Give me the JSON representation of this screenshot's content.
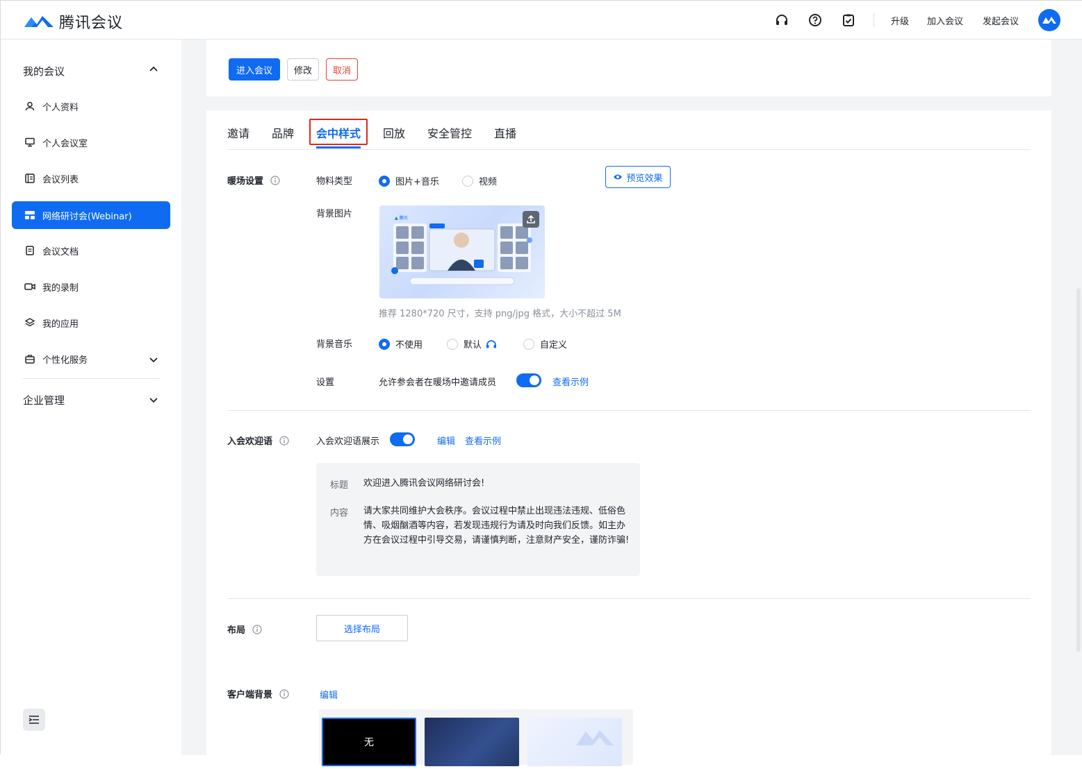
{
  "app": {
    "name": "腾讯会议"
  },
  "topbar": {
    "links": {
      "upgrade": "升级",
      "join": "加入会议",
      "start": "发起会议"
    },
    "icons": [
      "headset-icon",
      "help-icon",
      "clipboard-check-icon"
    ]
  },
  "sidebar": {
    "group_my": "我的会议",
    "items": [
      {
        "label": "个人资料",
        "icon": "user-icon"
      },
      {
        "label": "个人会议室",
        "icon": "monitor-icon"
      },
      {
        "label": "会议列表",
        "icon": "list-icon"
      },
      {
        "label": "网络研讨会(Webinar)",
        "icon": "webinar-icon",
        "active": true
      },
      {
        "label": "会议文档",
        "icon": "document-icon"
      },
      {
        "label": "我的录制",
        "icon": "video-icon"
      },
      {
        "label": "我的应用",
        "icon": "layers-icon"
      },
      {
        "label": "个性化服务",
        "icon": "briefcase-icon"
      }
    ],
    "group_enterprise": "企业管理"
  },
  "actions": {
    "enter": "进入会议",
    "edit": "修改",
    "cancel": "取消"
  },
  "tabs": [
    "邀请",
    "品牌",
    "会中样式",
    "回放",
    "安全管控",
    "直播"
  ],
  "active_tab": "会中样式",
  "warmup": {
    "title": "暖场设置",
    "material_label": "物料类型",
    "material_options": [
      "图片+音乐",
      "视频"
    ],
    "material_selected": "图片+音乐",
    "preview_btn": "预览效果",
    "bg_image_label": "背景图片",
    "bg_image_hint": "推荐 1280*720 尺寸，支持 png/jpg 格式，大小不超过 5M",
    "bg_music_label": "背景音乐",
    "bg_music_options": [
      "不使用",
      "默认",
      "自定义"
    ],
    "bg_music_selected": "不使用",
    "settings_label": "设置",
    "allow_invite_label": "允许参会者在暖场中邀请成员",
    "allow_invite_on": true,
    "view_example": "查看示例"
  },
  "welcome": {
    "title": "入会欢迎语",
    "show_label": "入会欢迎语展示",
    "show_on": true,
    "edit": "编辑",
    "view_example": "查看示例",
    "subject_key": "标题",
    "subject_val": "欢迎进入腾讯会议网络研讨会!",
    "content_key": "内容",
    "content_val": "请大家共同维护大会秩序。会议过程中禁止出现违法违规、低俗色情、吸烟酗酒等内容，若发现违规行为请及时向我们反馈。如主办方在会议过程中引导交易，请谨慎判断，注意财产安全，谨防诈骗!"
  },
  "layout": {
    "title": "布局",
    "select_btn": "选择布局"
  },
  "client_bg": {
    "title": "客户端背景",
    "edit": "编辑",
    "none_label": "无"
  },
  "colors": {
    "primary": "#0f6bf2",
    "danger": "#e0443a",
    "highlight": "#e0281e"
  }
}
